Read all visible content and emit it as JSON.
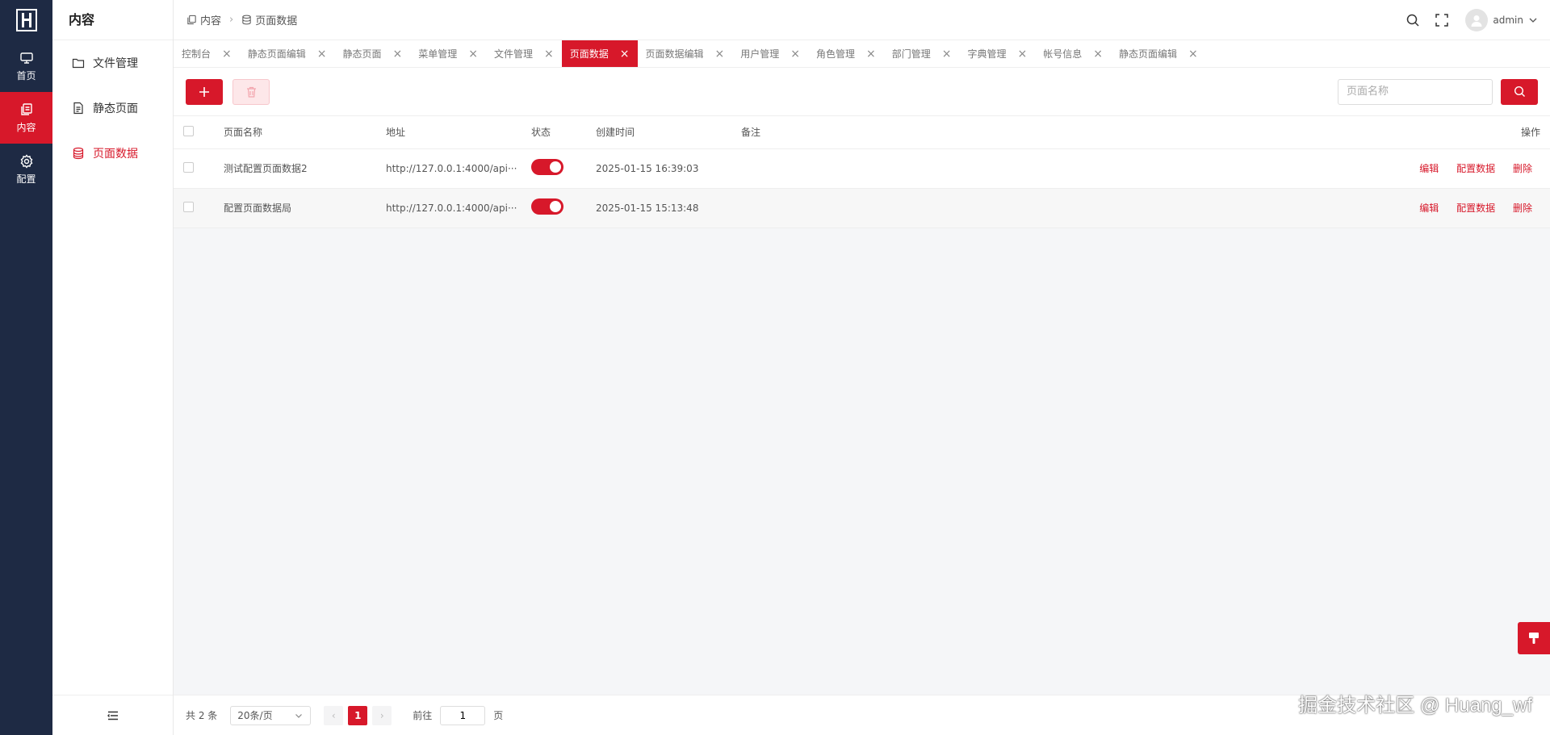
{
  "rail": {
    "items": [
      {
        "label": "首页",
        "icon": "monitor-icon"
      },
      {
        "label": "内容",
        "icon": "copy-icon"
      },
      {
        "label": "配置",
        "icon": "gear-icon"
      }
    ]
  },
  "sidebar": {
    "title": "内容",
    "items": [
      {
        "label": "文件管理",
        "icon": "folder-icon"
      },
      {
        "label": "静态页面",
        "icon": "document-icon"
      },
      {
        "label": "页面数据",
        "icon": "database-icon"
      }
    ]
  },
  "header": {
    "breadcrumb": [
      "内容",
      "页面数据"
    ],
    "user": "admin"
  },
  "tabs": [
    {
      "label": "控制台"
    },
    {
      "label": "静态页面编辑"
    },
    {
      "label": "静态页面"
    },
    {
      "label": "菜单管理"
    },
    {
      "label": "文件管理"
    },
    {
      "label": "页面数据"
    },
    {
      "label": "页面数据编辑"
    },
    {
      "label": "用户管理"
    },
    {
      "label": "角色管理"
    },
    {
      "label": "部门管理"
    },
    {
      "label": "字典管理"
    },
    {
      "label": "帐号信息"
    },
    {
      "label": "静态页面编辑"
    }
  ],
  "active_tab": "页面数据",
  "search": {
    "placeholder": "页面名称"
  },
  "table": {
    "columns": {
      "name": "页面名称",
      "address": "地址",
      "status": "状态",
      "created": "创建时间",
      "remark": "备注",
      "actions": "操作"
    },
    "rows": [
      {
        "name": "测试配置页面数据2",
        "address": "http://127.0.0.1:4000/api···",
        "status": true,
        "created": "2025-01-15 16:39:03",
        "remark": ""
      },
      {
        "name": "配置页面数据局",
        "address": "http://127.0.0.1:4000/api···",
        "status": true,
        "created": "2025-01-15 15:13:48",
        "remark": ""
      }
    ],
    "actions": {
      "edit": "编辑",
      "config": "配置数据",
      "delete": "删除"
    }
  },
  "pagination": {
    "total": "共 2 条",
    "page_size": "20条/页",
    "current": "1",
    "goto_label": "前往",
    "goto_value": "1",
    "page_unit": "页"
  },
  "watermark": "掘金技术社区 @ Huang_wf",
  "colors": {
    "accent": "#d7182a",
    "rail_bg": "#1e2a44"
  }
}
